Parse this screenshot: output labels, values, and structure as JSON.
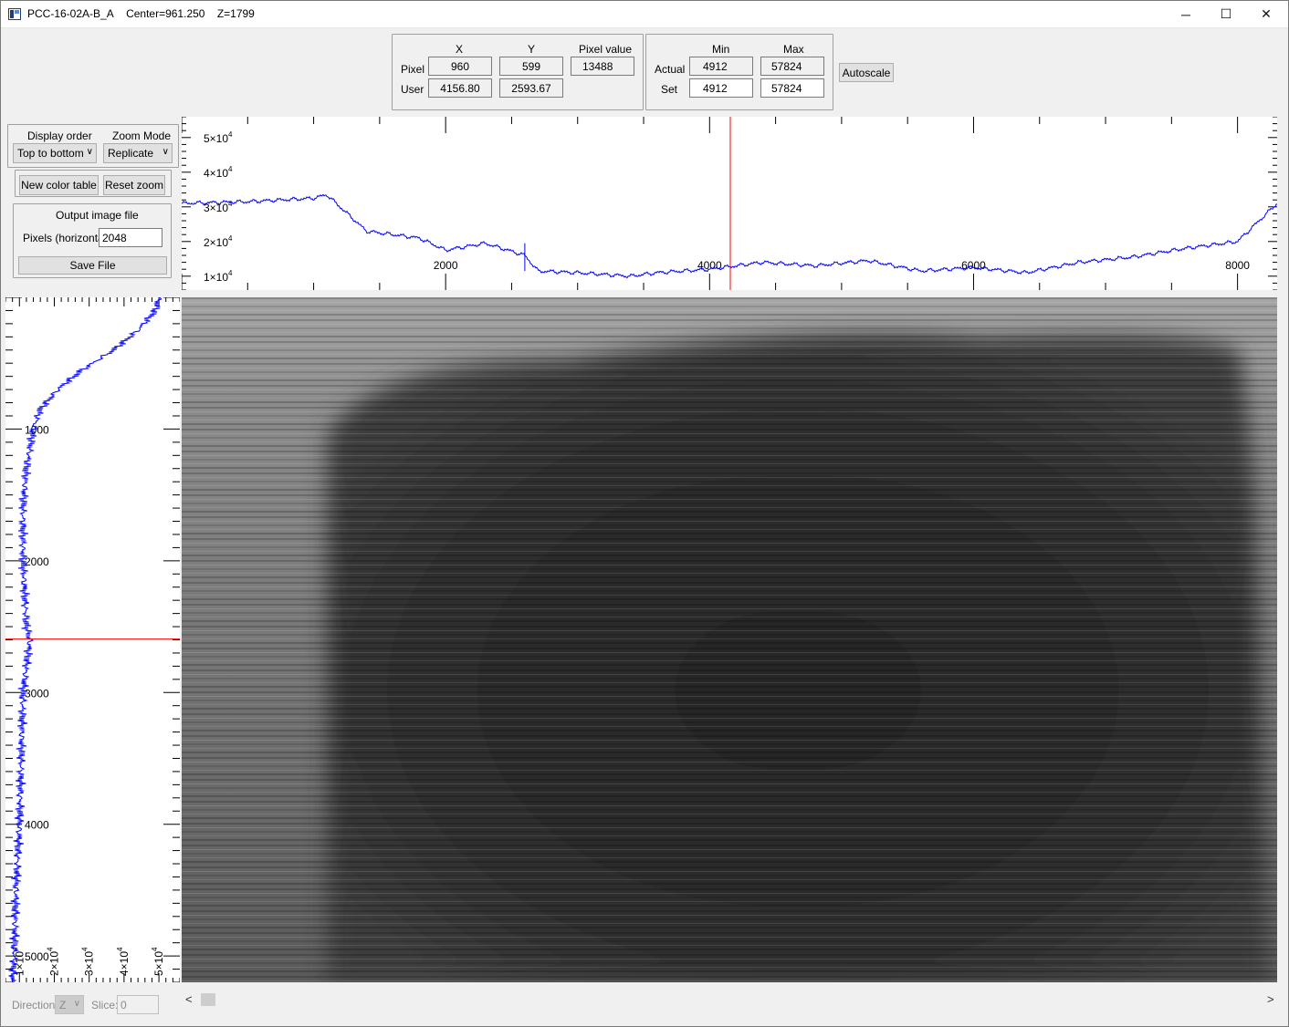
{
  "window": {
    "title": "PCC-16-02A-B_A",
    "center": "Center=961.250",
    "z": "Z=1799",
    "minimize": "─",
    "maximize": "☐",
    "close": "✕"
  },
  "info_panel": {
    "col_x": "X",
    "col_y": "Y",
    "col_pixel_value": "Pixel value",
    "row_pixel": "Pixel",
    "row_user": "User",
    "pixel_x": "960",
    "pixel_y": "599",
    "pixel_value": "13488",
    "user_x": "4156.80",
    "user_y": "2593.67"
  },
  "scale_panel": {
    "col_min": "Min",
    "col_max": "Max",
    "row_actual": "Actual",
    "row_set": "Set",
    "actual_min": "4912",
    "actual_max": "57824",
    "set_min": "4912",
    "set_max": "57824",
    "autoscale": "Autoscale"
  },
  "controls": {
    "display_order_label": "Display order",
    "display_order_value": "Top to bottom",
    "zoom_mode_label": "Zoom Mode",
    "zoom_mode_value": "Replicate",
    "new_color_table": "New color table",
    "reset_zoom": "Reset zoom",
    "output_image_file": "Output image file",
    "pixels_horizontal_label": "Pixels (horizontal)",
    "pixels_horizontal_value": "2048",
    "save_file": "Save File"
  },
  "bottom_bar": {
    "direction_label": "Direction:",
    "direction_value": "Z",
    "slice_label": "Slice:",
    "slice_value": "0",
    "scroll_left": "<",
    "scroll_right": ">"
  },
  "colors": {
    "profile_line": "#0000ff",
    "cursor_line": "#ff0000"
  },
  "chart_data": [
    {
      "type": "line",
      "name": "horizontal-profile",
      "x_ticks": [
        "2000",
        "4000",
        "6000",
        "8000"
      ],
      "x_tick_values": [
        2000,
        4000,
        6000,
        8000
      ],
      "y_ticks": [
        "1×10",
        "2×10",
        "3×10",
        "4×10",
        "5×10"
      ],
      "y_tick_values": [
        10000,
        20000,
        30000,
        40000,
        50000
      ],
      "y_tick_exp": "4",
      "xlim": [
        0,
        8300
      ],
      "ylim": [
        6000,
        56000
      ],
      "cursor_x": 4156.8,
      "x": [
        0,
        500,
        1000,
        1100,
        1400,
        1800,
        2000,
        2300,
        2600,
        2700,
        3000,
        3400,
        3600,
        4000,
        4400,
        4800,
        5200,
        5600,
        6000,
        6400,
        6800,
        7200,
        7600,
        8000,
        8300
      ],
      "y": [
        31000,
        31500,
        32500,
        33500,
        23000,
        21000,
        17500,
        19500,
        16000,
        11500,
        11000,
        10000,
        11000,
        12000,
        14000,
        13000,
        14500,
        11500,
        12500,
        11000,
        14000,
        15500,
        18000,
        20000,
        31000
      ]
    },
    {
      "type": "line",
      "name": "vertical-profile",
      "y_ticks": [
        "1000",
        "2000",
        "3000",
        "4000",
        "5000"
      ],
      "y_tick_values": [
        1000,
        2000,
        3000,
        4000,
        5000
      ],
      "x_ticks": [
        "1×10",
        "2×10",
        "3×10",
        "4×10",
        "5×10"
      ],
      "x_tick_values": [
        10000,
        20000,
        30000,
        40000,
        50000
      ],
      "x_tick_exp": "4",
      "ylim": [
        0,
        5200
      ],
      "xlim": [
        6000,
        56000
      ],
      "cursor_y": 2593.67,
      "row": [
        0,
        100,
        250,
        400,
        550,
        700,
        850,
        1000,
        1300,
        1600,
        2000,
        2500,
        2600,
        3000,
        3500,
        4000,
        4500,
        5000,
        5200
      ],
      "value": [
        50000,
        49000,
        44000,
        37000,
        28000,
        21000,
        16000,
        14000,
        12000,
        11000,
        11000,
        12000,
        13000,
        11000,
        10500,
        10000,
        9000,
        8500,
        8000
      ]
    }
  ]
}
